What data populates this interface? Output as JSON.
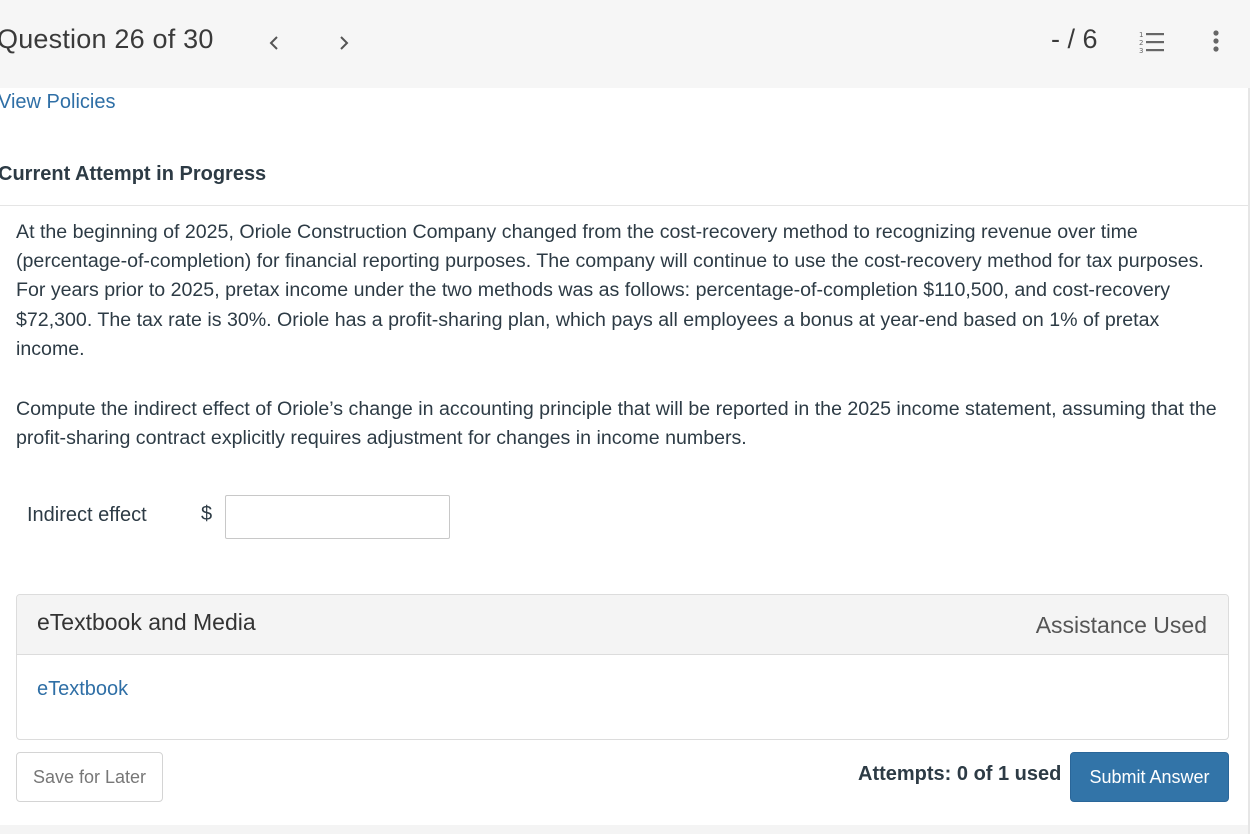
{
  "header": {
    "question_counter": "Question 26 of 30",
    "prev_icon": "chevron-left-icon",
    "next_icon": "chevron-right-icon",
    "score": "- / 6",
    "list_icon": "numbered-list-icon",
    "more_icon": "more-vertical-icon"
  },
  "links": {
    "view_policies": "View Policies"
  },
  "attempt": {
    "heading": "Current Attempt in Progress"
  },
  "question": {
    "text": "At the beginning of 2025, Oriole Construction Company changed from the cost-recovery method to recognizing revenue over time (percentage-of-completion) for financial reporting purposes. The company will continue to use the cost-recovery method for tax purposes. For years prior to 2025, pretax income under the two methods was as follows: percentage-of-completion $110,500, and cost-recovery $72,300. The tax rate is 30%. Oriole has a profit-sharing plan, which pays all employees a bonus at year-end based on 1% of pretax income.",
    "instruction": "Compute the indirect effect of Oriole’s change in accounting principle that will be reported in the 2025 income statement, assuming that the profit-sharing contract explicitly requires adjustment for changes in income numbers."
  },
  "answer": {
    "label": "Indirect effect",
    "currency": "$",
    "value": "",
    "placeholder": ""
  },
  "media_panel": {
    "title": "eTextbook and Media",
    "assistance": "Assistance Used",
    "link": "eTextbook"
  },
  "footer": {
    "save_label": "Save for Later",
    "attempts": "Attempts: 0 of 1 used",
    "submit_label": "Submit Answer"
  },
  "colors": {
    "link": "#2f6fa6",
    "primary_button": "#3274a8",
    "header_bg": "#f6f6f6",
    "text": "#2d3b45"
  }
}
